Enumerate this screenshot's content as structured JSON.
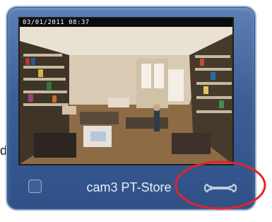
{
  "sidebar": {
    "edge_letter": "d"
  },
  "camera_tile": {
    "timestamp": "03/01/2011 08:37",
    "name": "cam3 PT-Store",
    "settings_icon": "wrench-icon",
    "select_checkbox_checked": false
  },
  "annotation": {
    "color": "#e4222b",
    "shape": "ellipse"
  },
  "colors": {
    "tile_top": "#5d7fb4",
    "tile_bottom": "#2f5187",
    "label_text": "#e7eef8"
  }
}
